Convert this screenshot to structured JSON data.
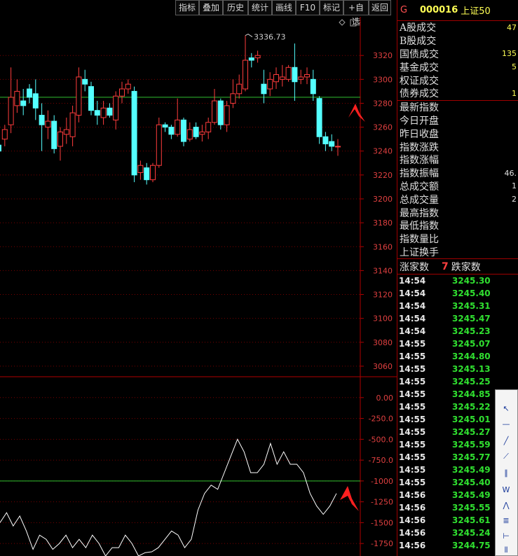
{
  "toolbar": [
    "指标",
    "叠加",
    "历史",
    "统计",
    "画线",
    "F10",
    "标记",
    "+自选",
    "返回"
  ],
  "price_axis": [
    "3320",
    "3300",
    "3280",
    "3260",
    "3240",
    "3220",
    "3200",
    "3180",
    "3160",
    "3140",
    "3120",
    "3100",
    "3080",
    "3060"
  ],
  "indicator_axis": [
    "0.00",
    "-250.0",
    "-500.0",
    "-750.0",
    "-1000",
    "-1250",
    "-1500",
    "-1750"
  ],
  "high_annotation": "3336.73",
  "quote": {
    "g": "G",
    "code": "000016",
    "name": "上证50",
    "rows1": [
      {
        "label": "A股成交",
        "value": "47"
      },
      {
        "label": "B股成交",
        "value": ""
      },
      {
        "label": "国债成交",
        "value": "135"
      },
      {
        "label": "基金成交",
        "value": "5"
      },
      {
        "label": "权证成交",
        "value": ""
      },
      {
        "label": "债券成交",
        "value": "1"
      }
    ],
    "rows2": [
      {
        "label": "最新指数",
        "value": ""
      },
      {
        "label": "今日开盘",
        "value": ""
      },
      {
        "label": "昨日收盘",
        "value": ""
      },
      {
        "label": "指数涨跌",
        "value": ""
      },
      {
        "label": "指数涨幅",
        "value": ""
      },
      {
        "label": "指数振幅",
        "value": "46."
      },
      {
        "label": "总成交额",
        "value": "1"
      },
      {
        "label": "总成交量",
        "value": "2"
      },
      {
        "label": "最高指数",
        "value": ""
      },
      {
        "label": "最低指数",
        "value": ""
      },
      {
        "label": "指数量比",
        "value": ""
      },
      {
        "label": "上证换手",
        "value": ""
      }
    ],
    "up_label": "涨家数",
    "up_count": "7",
    "down_label": "跌家数",
    "ticks": [
      {
        "time": "14:54",
        "price": "3245.30"
      },
      {
        "time": "14:54",
        "price": "3245.40"
      },
      {
        "time": "14:54",
        "price": "3245.31"
      },
      {
        "time": "14:54",
        "price": "3245.47"
      },
      {
        "time": "14:54",
        "price": "3245.23"
      },
      {
        "time": "14:55",
        "price": "3245.07"
      },
      {
        "time": "14:55",
        "price": "3244.80"
      },
      {
        "time": "14:55",
        "price": "3245.13"
      },
      {
        "time": "14:55",
        "price": "3245.25"
      },
      {
        "time": "14:55",
        "price": "3244.85"
      },
      {
        "time": "14:55",
        "price": "3245.22"
      },
      {
        "time": "14:55",
        "price": "3245.01"
      },
      {
        "time": "14:55",
        "price": "3245.27"
      },
      {
        "time": "14:55",
        "price": "3245.59"
      },
      {
        "time": "14:55",
        "price": "3245.77"
      },
      {
        "time": "14:55",
        "price": "3245.49"
      },
      {
        "time": "14:55",
        "price": "3245.40"
      },
      {
        "time": "14:56",
        "price": "3245.49"
      },
      {
        "time": "14:56",
        "price": "3245.55"
      },
      {
        "time": "14:56",
        "price": "3245.61"
      },
      {
        "time": "14:56",
        "price": "3245.24"
      },
      {
        "time": "14:56",
        "price": "3244.75"
      }
    ]
  },
  "chart_data": {
    "type": "candlestick",
    "ylim": [
      3050,
      3350
    ],
    "reference_price": 3285,
    "candles": [
      {
        "o": 3245,
        "c": 3240,
        "h": 3250,
        "l": 3232
      },
      {
        "o": 3250,
        "c": 3258,
        "h": 3262,
        "l": 3244
      },
      {
        "o": 3262,
        "c": 3285,
        "h": 3310,
        "l": 3255
      },
      {
        "o": 3278,
        "c": 3290,
        "h": 3300,
        "l": 3272
      },
      {
        "o": 3282,
        "c": 3278,
        "h": 3292,
        "l": 3270
      },
      {
        "o": 3292,
        "c": 3285,
        "h": 3296,
        "l": 3280
      },
      {
        "o": 3288,
        "c": 3276,
        "h": 3300,
        "l": 3266
      },
      {
        "o": 3270,
        "c": 3262,
        "h": 3280,
        "l": 3240
      },
      {
        "o": 3260,
        "c": 3265,
        "h": 3274,
        "l": 3250
      },
      {
        "o": 3265,
        "c": 3242,
        "h": 3270,
        "l": 3238
      },
      {
        "o": 3244,
        "c": 3256,
        "h": 3260,
        "l": 3232
      },
      {
        "o": 3254,
        "c": 3258,
        "h": 3268,
        "l": 3246
      },
      {
        "o": 3252,
        "c": 3272,
        "h": 3278,
        "l": 3244
      },
      {
        "o": 3270,
        "c": 3302,
        "h": 3310,
        "l": 3264
      },
      {
        "o": 3300,
        "c": 3296,
        "h": 3308,
        "l": 3290
      },
      {
        "o": 3294,
        "c": 3274,
        "h": 3298,
        "l": 3270
      },
      {
        "o": 3274,
        "c": 3270,
        "h": 3282,
        "l": 3262
      },
      {
        "o": 3268,
        "c": 3276,
        "h": 3282,
        "l": 3262
      },
      {
        "o": 3276,
        "c": 3270,
        "h": 3280,
        "l": 3268
      },
      {
        "o": 3266,
        "c": 3286,
        "h": 3290,
        "l": 3258
      },
      {
        "o": 3286,
        "c": 3292,
        "h": 3298,
        "l": 3280
      },
      {
        "o": 3292,
        "c": 3296,
        "h": 3300,
        "l": 3288
      },
      {
        "o": 3290,
        "c": 3220,
        "h": 3294,
        "l": 3214
      },
      {
        "o": 3222,
        "c": 3228,
        "h": 3232,
        "l": 3216
      },
      {
        "o": 3226,
        "c": 3216,
        "h": 3230,
        "l": 3212
      },
      {
        "o": 3216,
        "c": 3228,
        "h": 3230,
        "l": 3214
      },
      {
        "o": 3228,
        "c": 3262,
        "h": 3268,
        "l": 3226
      },
      {
        "o": 3262,
        "c": 3260,
        "h": 3264,
        "l": 3256
      },
      {
        "o": 3260,
        "c": 3254,
        "h": 3262,
        "l": 3250
      },
      {
        "o": 3254,
        "c": 3266,
        "h": 3284,
        "l": 3252
      },
      {
        "o": 3266,
        "c": 3248,
        "h": 3268,
        "l": 3244
      },
      {
        "o": 3250,
        "c": 3258,
        "h": 3264,
        "l": 3248
      },
      {
        "o": 3260,
        "c": 3252,
        "h": 3264,
        "l": 3250
      },
      {
        "o": 3254,
        "c": 3256,
        "h": 3262,
        "l": 3248
      },
      {
        "o": 3256,
        "c": 3264,
        "h": 3268,
        "l": 3250
      },
      {
        "o": 3264,
        "c": 3282,
        "h": 3292,
        "l": 3262
      },
      {
        "o": 3282,
        "c": 3262,
        "h": 3284,
        "l": 3258
      },
      {
        "o": 3262,
        "c": 3278,
        "h": 3282,
        "l": 3256
      },
      {
        "o": 3280,
        "c": 3288,
        "h": 3300,
        "l": 3276
      },
      {
        "o": 3288,
        "c": 3296,
        "h": 3304,
        "l": 3284
      },
      {
        "o": 3292,
        "c": 3316,
        "h": 3336.73,
        "l": 3290
      },
      {
        "o": 3318,
        "c": 3316,
        "h": 3322,
        "l": 3310
      },
      {
        "o": 3318,
        "c": 3320,
        "h": 3324,
        "l": 3314
      },
      {
        "o": 3296,
        "c": 3288,
        "h": 3308,
        "l": 3280
      },
      {
        "o": 3292,
        "c": 3300,
        "h": 3306,
        "l": 3286
      },
      {
        "o": 3298,
        "c": 3304,
        "h": 3310,
        "l": 3292
      },
      {
        "o": 3300,
        "c": 3302,
        "h": 3312,
        "l": 3294
      },
      {
        "o": 3300,
        "c": 3310,
        "h": 3312,
        "l": 3298
      },
      {
        "o": 3310,
        "c": 3298,
        "h": 3330,
        "l": 3282
      },
      {
        "o": 3300,
        "c": 3302,
        "h": 3308,
        "l": 3296
      },
      {
        "o": 3302,
        "c": 3304,
        "h": 3310,
        "l": 3296
      },
      {
        "o": 3300,
        "c": 3288,
        "h": 3308,
        "l": 3282
      },
      {
        "o": 3284,
        "c": 3252,
        "h": 3286,
        "l": 3246
      },
      {
        "o": 3252,
        "c": 3246,
        "h": 3256,
        "l": 3240
      },
      {
        "o": 3248,
        "c": 3244,
        "h": 3254,
        "l": 3240
      },
      {
        "o": 3244,
        "c": 3244,
        "h": 3250,
        "l": 3236
      }
    ],
    "candle_colors": {
      "up": "#ff3c3c",
      "down": "#54ffff"
    },
    "indicator": {
      "ylim": [
        -1900,
        200
      ],
      "reference_value": -1000,
      "values": [
        -1500,
        -1380,
        -1540,
        -1420,
        -1600,
        -1820,
        -1650,
        -1700,
        -1820,
        -1750,
        -1650,
        -1800,
        -1700,
        -1800,
        -1650,
        -1750,
        -1900,
        -1800,
        -1800,
        -1650,
        -1750,
        -1900,
        -1860,
        -1850,
        -1800,
        -1700,
        -1600,
        -1650,
        -1800,
        -1700,
        -1350,
        -1150,
        -1050,
        -1100,
        -900,
        -700,
        -500,
        -650,
        -900,
        -900,
        -800,
        -550,
        -800,
        -650,
        -800,
        -800,
        -900,
        -1150,
        -1300,
        -1400,
        -1300,
        -1150
      ]
    }
  }
}
